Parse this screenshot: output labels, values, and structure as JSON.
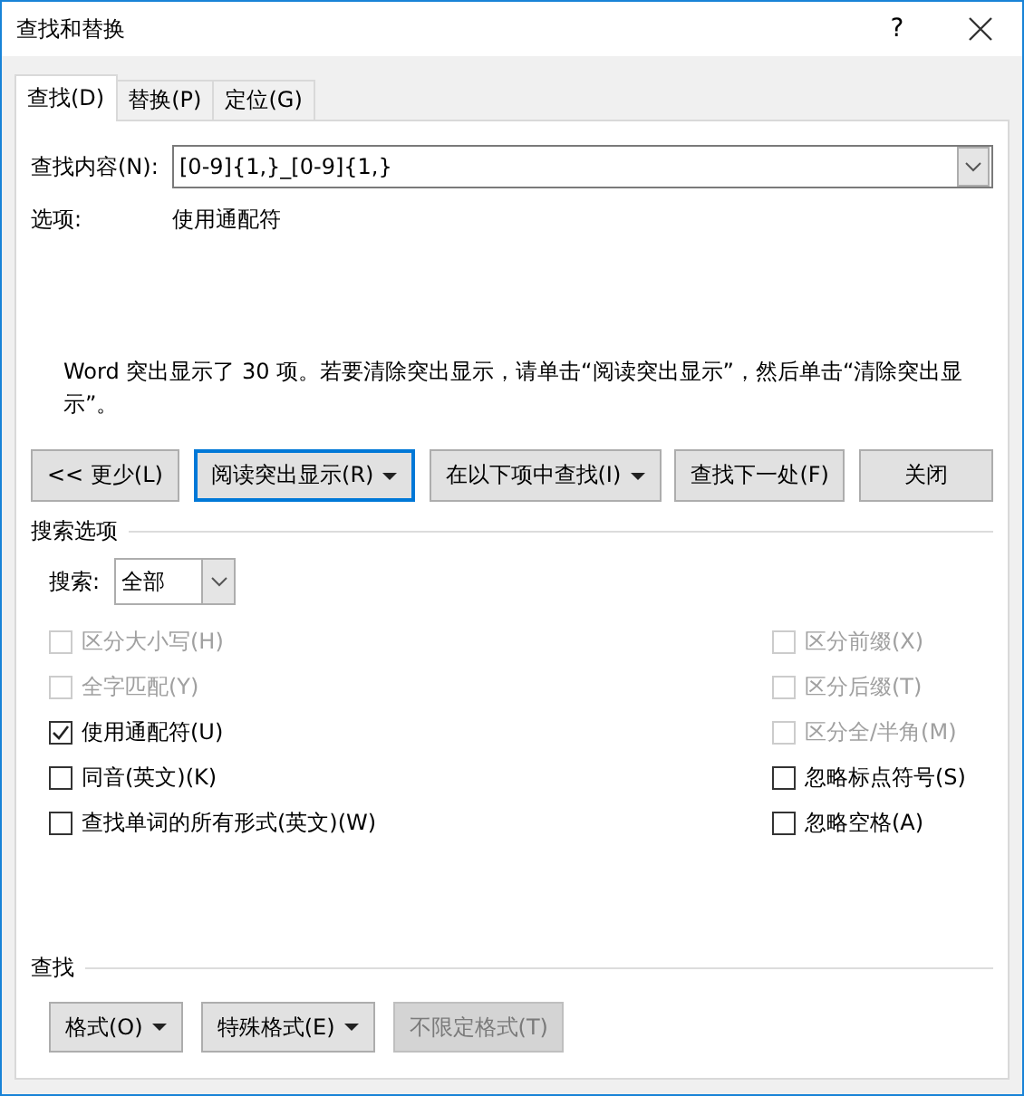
{
  "window": {
    "title": "查找和替换",
    "help": "?"
  },
  "tabs": [
    {
      "label": "查找(D)",
      "selected": true
    },
    {
      "label": "替换(P)",
      "selected": false
    },
    {
      "label": "定位(G)",
      "selected": false
    }
  ],
  "find": {
    "label": "查找内容(N):",
    "value": "[0-9]{1,}_[0-9]{1,}"
  },
  "options": {
    "label": "选项:",
    "value": "使用通配符"
  },
  "message": "Word 突出显示了 30 项。若要清除突出显示，请单击“阅读突出显示”，然后单击“清除突出显示”。",
  "buttons": [
    {
      "label": "<< 更少(L)",
      "dropdown": false,
      "focused": false
    },
    {
      "label": "阅读突出显示(R)",
      "dropdown": true,
      "focused": true
    },
    {
      "label": "在以下项中查找(I)",
      "dropdown": true,
      "focused": false
    },
    {
      "label": "查找下一处(F)",
      "dropdown": false,
      "focused": false
    },
    {
      "label": "关闭",
      "dropdown": false,
      "focused": false
    }
  ],
  "search_options": {
    "heading": "搜索选项",
    "search_label": "搜索:",
    "search_value": "全部",
    "left": [
      {
        "label": "区分大小写(H)",
        "checked": false,
        "disabled": true
      },
      {
        "label": "全字匹配(Y)",
        "checked": false,
        "disabled": true
      },
      {
        "label": "使用通配符(U)",
        "checked": true,
        "disabled": false
      },
      {
        "label": "同音(英文)(K)",
        "checked": false,
        "disabled": false
      },
      {
        "label": "查找单词的所有形式(英文)(W)",
        "checked": false,
        "disabled": false
      }
    ],
    "right": [
      {
        "label": "区分前缀(X)",
        "checked": false,
        "disabled": true
      },
      {
        "label": "区分后缀(T)",
        "checked": false,
        "disabled": true
      },
      {
        "label": "区分全/半角(M)",
        "checked": false,
        "disabled": true
      },
      {
        "label": "忽略标点符号(S)",
        "checked": false,
        "disabled": false
      },
      {
        "label": "忽略空格(A)",
        "checked": false,
        "disabled": false
      }
    ]
  },
  "find_section": {
    "heading": "查找",
    "buttons": [
      {
        "label": "格式(O)",
        "dropdown": true,
        "disabled": false
      },
      {
        "label": "特殊格式(E)",
        "dropdown": true,
        "disabled": false
      },
      {
        "label": "不限定格式(T)",
        "dropdown": false,
        "disabled": true
      }
    ]
  }
}
